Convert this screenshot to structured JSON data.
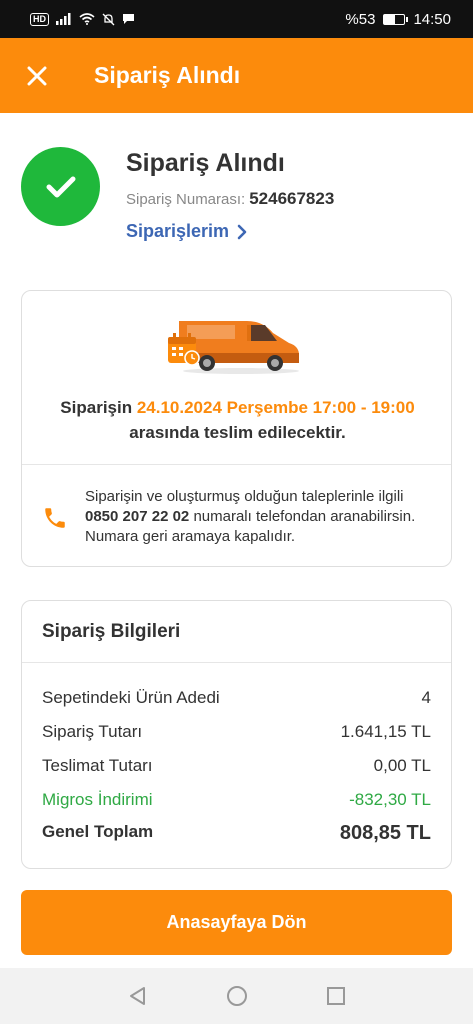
{
  "status_bar": {
    "hd_label": "HD",
    "battery_text": "%53",
    "battery_level": 0.53,
    "time": "14:50"
  },
  "header": {
    "title": "Sipariş Alındı",
    "close_icon": "close-icon"
  },
  "success": {
    "title": "Sipariş Alındı",
    "order_number_label": "Sipariş Numarası:",
    "order_number": "524667823",
    "orders_link": "Siparişlerim"
  },
  "delivery": {
    "text_before": "Siparişin ",
    "time_window": "24.10.2024 Perşembe 17:00 - 19:00",
    "text_after": " arasında teslim edilecektir.",
    "contact_before": "Siparişin ve oluşturmuş olduğun taleplerinle ilgili ",
    "phone_number": "0850 207 22 02",
    "contact_after": " numaralı telefondan aranabilirsin. Numara geri aramaya kapalıdır."
  },
  "order_info": {
    "title": "Sipariş Bilgileri",
    "rows": [
      {
        "label": "Sepetindeki Ürün Adedi",
        "value": "4"
      },
      {
        "label": "Sipariş Tutarı",
        "value": "1.641,15 TL"
      },
      {
        "label": "Teslimat Tutarı",
        "value": "0,00 TL"
      },
      {
        "label": "Migros İndirimi",
        "value": "-832,30 TL"
      },
      {
        "label": "Genel Toplam",
        "value": "808,85 TL"
      }
    ]
  },
  "home_button": "Anasayfaya Dön",
  "colors": {
    "brand_orange": "#fc8b0c",
    "success_green": "#1fb83b",
    "discount_green": "#2fa944",
    "link_blue": "#3d67b4"
  }
}
